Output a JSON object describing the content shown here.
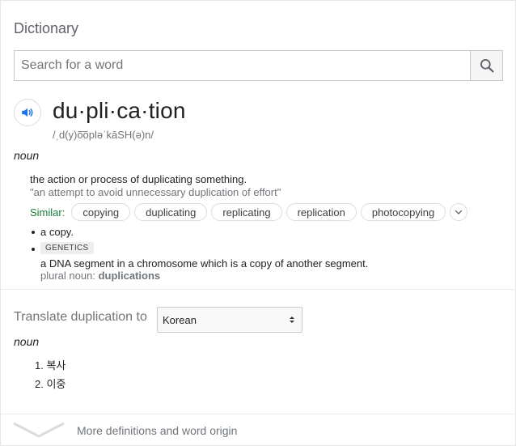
{
  "header": {
    "title": "Dictionary"
  },
  "search": {
    "placeholder": "Search for a word",
    "button_icon": "search-icon"
  },
  "entry": {
    "word": "du·pli·ca·tion",
    "pronunciation": "/ˌd(y)o͞opləˈkāSH(ə)n/",
    "part_of_speech": "noun",
    "senses": [
      {
        "definition": "the action or process of duplicating something.",
        "example": "\"an attempt to avoid unnecessary duplication of effort\"",
        "similar_label": "Similar:",
        "similar": [
          "copying",
          "duplicating",
          "replicating",
          "replication",
          "photocopying"
        ]
      }
    ],
    "sub_senses": [
      {
        "definition": "a copy."
      },
      {
        "tag": "GENETICS",
        "definition": "a DNA segment in a chromosome which is a copy of another segment.",
        "plural_label": "plural noun:",
        "plural_value": "duplications"
      }
    ]
  },
  "translate": {
    "label": "Translate duplication to",
    "language": "Korean",
    "part_of_speech": "noun",
    "items": [
      "1. 복사",
      "2. 이중"
    ]
  },
  "footer": {
    "more_label": "More definitions and word origin"
  },
  "colors": {
    "accent_blue": "#1a73e8",
    "similar_green": "#188038",
    "muted": "#70757a"
  }
}
